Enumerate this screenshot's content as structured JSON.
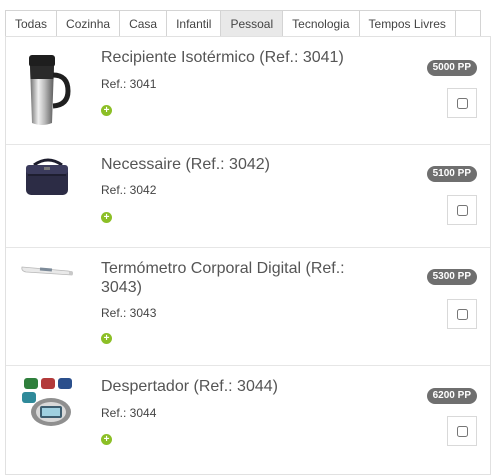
{
  "tabs": [
    {
      "label": "Todas"
    },
    {
      "label": "Cozinha"
    },
    {
      "label": "Casa"
    },
    {
      "label": "Infantil"
    },
    {
      "label": "Pessoal",
      "active": true
    },
    {
      "label": "Tecnologia"
    },
    {
      "label": "Tempos Livres"
    }
  ],
  "products": [
    {
      "title": "Recipiente Isotérmico (Ref.: 3041)",
      "ref": "Ref.: 3041",
      "price": "5000 PP",
      "plus": "+",
      "icon": "thermal-mug"
    },
    {
      "title": "Necessaire (Ref.: 3042)",
      "ref": "Ref.: 3042",
      "price": "5100 PP",
      "plus": "+",
      "icon": "toiletry-bag"
    },
    {
      "title": "Termómetro Corporal Digital (Ref.: 3043)",
      "ref": "Ref.: 3043",
      "price": "5300 PP",
      "plus": "+",
      "icon": "digital-thermometer"
    },
    {
      "title": "Despertador (Ref.: 3044)",
      "ref": "Ref.: 3044",
      "price": "6200 PP",
      "plus": "+",
      "icon": "alarm-clock"
    }
  ],
  "colors": {
    "accent_green": "#8cbf26",
    "price_badge": "#6f6f6f"
  }
}
